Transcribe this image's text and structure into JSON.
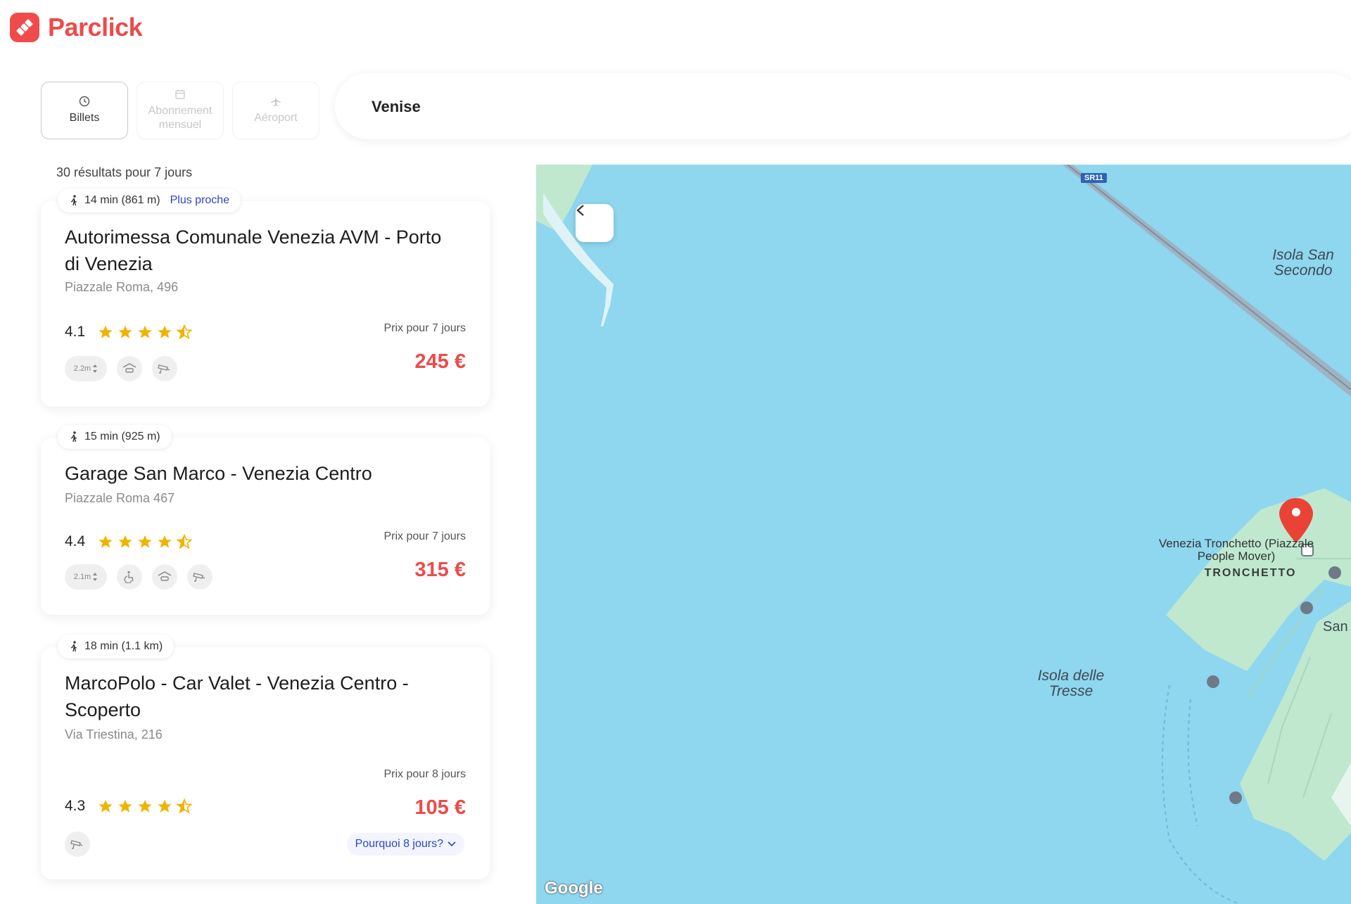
{
  "brand": {
    "name": "Parclick",
    "accent": "#ee4a4a"
  },
  "tabs": [
    {
      "label": "Billets",
      "icon": "clock-icon",
      "active": true
    },
    {
      "label": "Abonnement mensuel",
      "icon": "calendar-icon",
      "active": false
    },
    {
      "label": "Aéroport",
      "icon": "plane-icon",
      "active": false
    }
  ],
  "search": {
    "value": "Venise"
  },
  "results_summary": "30 résultats pour 7 jours",
  "listings": [
    {
      "walk": "14 min (861 m)",
      "tag": "Plus proche",
      "name": "Autorimessa Comunale Venezia AVM - Porto di Venezia",
      "address": "Piazzale Roma, 496",
      "rating": "4.1",
      "stars": 4.5,
      "height_label": "2.2m",
      "price_label": "Prix pour 7 jours",
      "price": "245 €"
    },
    {
      "walk": "15 min (925 m)",
      "name": "Garage San Marco - Venezia Centro",
      "address": "Piazzale Roma 467",
      "rating": "4.4",
      "stars": 4.5,
      "height_label": "2.1m",
      "price_label": "Prix pour 7 jours",
      "price": "315 €"
    },
    {
      "walk": "18 min (1.1 km)",
      "name": "MarcoPolo - Car Valet - Venezia Centro - Scoperto",
      "address": "Via Triestina, 216",
      "rating": "4.3",
      "stars": 4.5,
      "price_label": "Prix pour 8 jours",
      "price": "105 €",
      "why_label": "Pourquoi  8 jours?"
    }
  ],
  "map": {
    "road": "SR11",
    "labels": {
      "san_secondo": "Isola San Secondo",
      "tresse": "Isola delle Tresse",
      "tronchetto_station": "Venezia Tronchetto (Piazzale People Mover)",
      "tronchetto": "TRONCHETTO",
      "san": "San"
    },
    "attribution": "Google",
    "water_color": "#8fd6ef",
    "land_color": "#bfe8cf"
  }
}
